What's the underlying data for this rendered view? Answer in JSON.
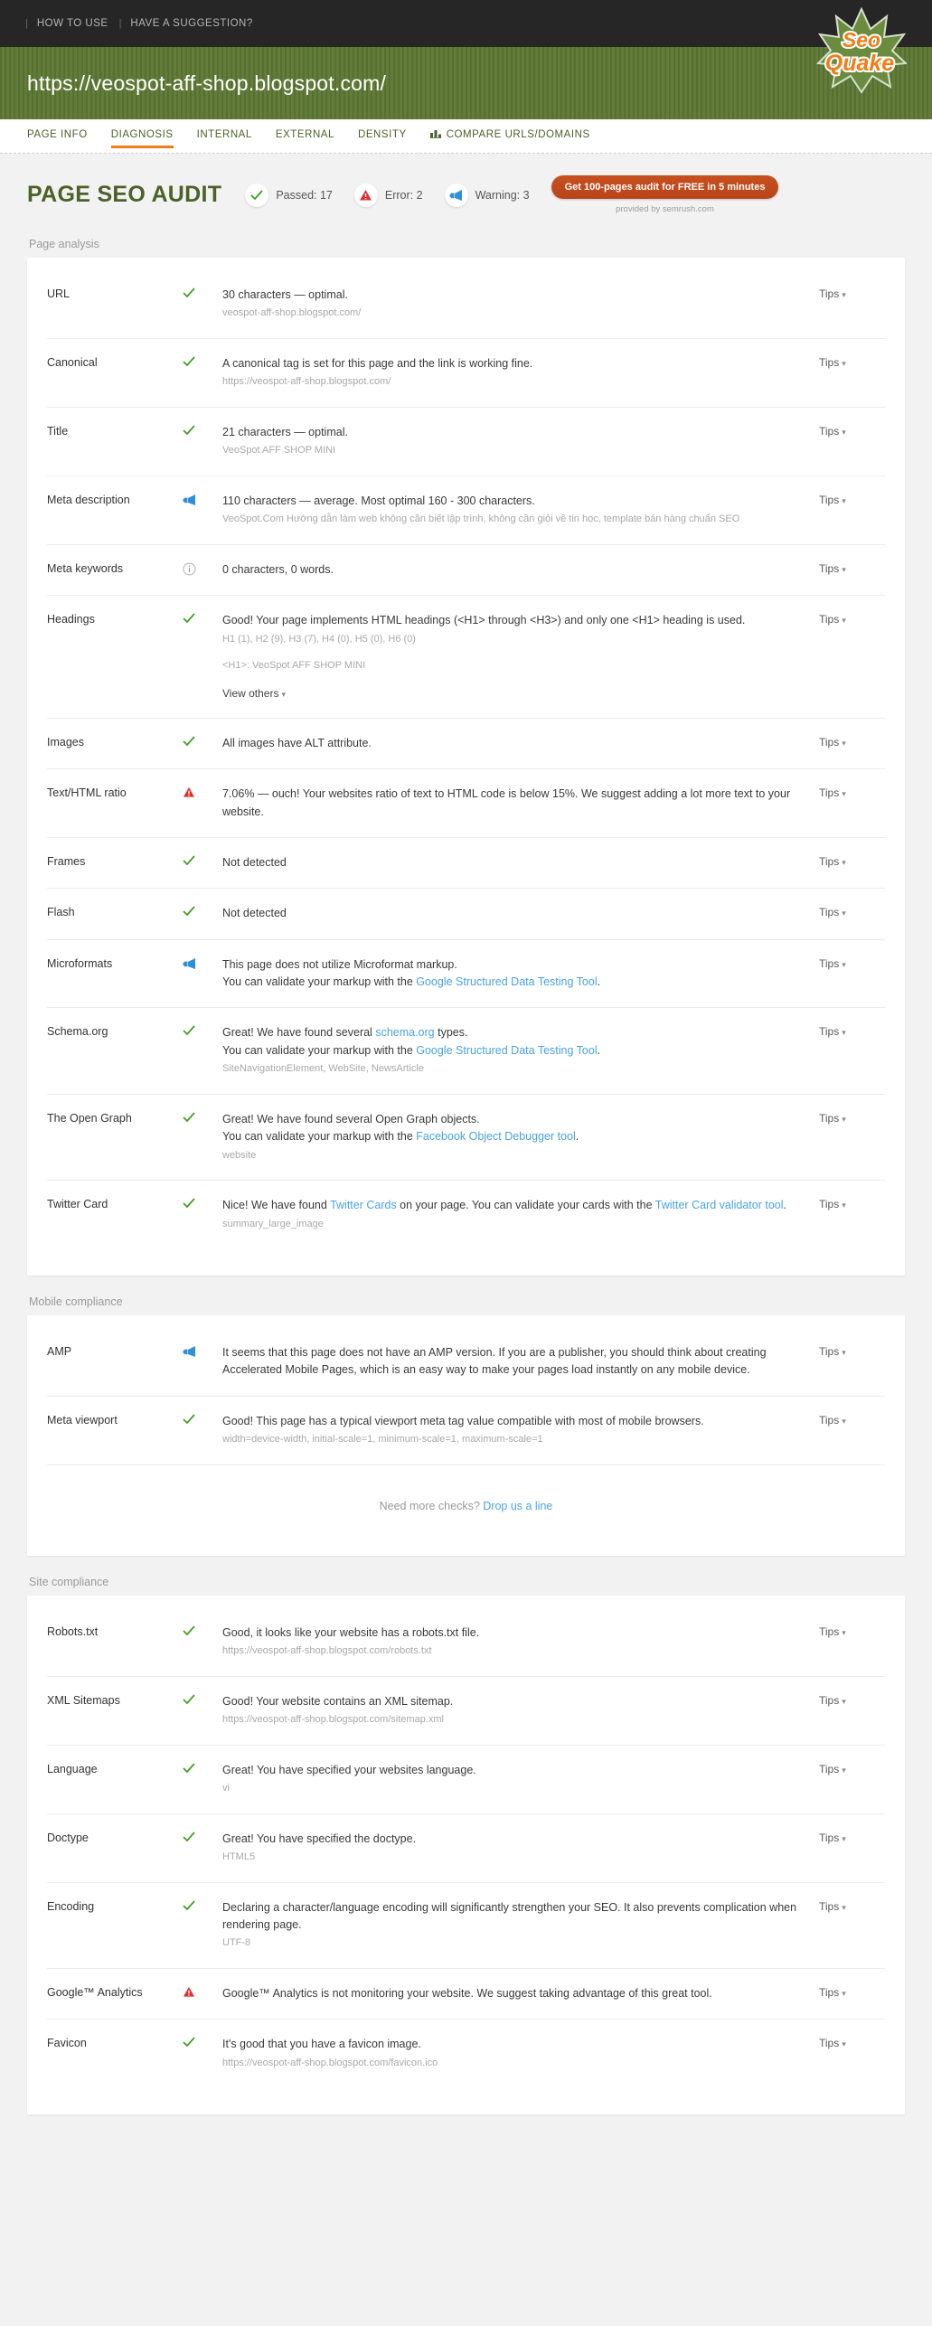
{
  "topbar": {
    "links": [
      {
        "label": "HOW TO USE",
        "name": "how-to-use-link"
      },
      {
        "label": "HAVE A SUGGESTION?",
        "name": "have-a-suggestion-link"
      }
    ],
    "separator": "|"
  },
  "urlbar": {
    "url": "https://veospot-aff-shop.blogspot.com/"
  },
  "logo": {
    "text_top": "Seo",
    "text_bottom": "Quake",
    "alt": "SeoQuake logo"
  },
  "tabs": [
    {
      "label": "PAGE INFO",
      "active": false
    },
    {
      "label": "DIAGNOSIS",
      "active": true
    },
    {
      "label": "INTERNAL",
      "active": false
    },
    {
      "label": "EXTERNAL",
      "active": false
    },
    {
      "label": "DENSITY",
      "active": false
    },
    {
      "label": "COMPARE URLS/DOMAINS",
      "active": false,
      "icon": "bar-chart-icon"
    }
  ],
  "audit": {
    "title": "PAGE SEO AUDIT",
    "stats": [
      {
        "icon": "check-icon",
        "label": "Passed: 17"
      },
      {
        "icon": "error-triangle-icon",
        "label": "Error: 2"
      },
      {
        "icon": "megaphone-icon",
        "label": "Warning: 3"
      }
    ],
    "cta_label": "Get 100-pages audit for FREE in 5 minutes",
    "cta_sub": "provided by  semrush.com"
  },
  "colors": {
    "green": "#5c7733",
    "orange": "#f07d1a",
    "link": "#4aa3df",
    "check": "#3e9c1f",
    "error": "#e03131",
    "warning": "#2f8fd9",
    "cta": "#c8501f"
  },
  "sections": [
    {
      "title": "Page analysis",
      "rows": [
        {
          "label": "URL",
          "icon": "check-icon",
          "tips": "Tips",
          "main": [
            {
              "t": "30 characters — optimal."
            }
          ],
          "sub": [
            "veospot-aff-shop.blogspot.com/"
          ]
        },
        {
          "label": "Canonical",
          "icon": "check-icon",
          "tips": "Tips",
          "main": [
            {
              "t": "A canonical tag is set for this page and the link is working fine."
            }
          ],
          "sub": [
            "https://veospot-aff-shop.blogspot.com/"
          ]
        },
        {
          "label": "Title",
          "icon": "check-icon",
          "tips": "Tips",
          "main": [
            {
              "t": "21 characters — optimal."
            }
          ],
          "sub": [
            "VeoSpot AFF SHOP MINI"
          ]
        },
        {
          "label": "Meta description",
          "icon": "megaphone-icon",
          "tips": "Tips",
          "main": [
            {
              "t": "110 characters — average. Most optimal 160 - 300 characters."
            }
          ],
          "sub": [
            "VeoSpot.Com Hướng dẫn làm web không cần biết lập trình, không cần giỏi về tin học, template bán hàng chuẩn SEO"
          ]
        },
        {
          "label": "Meta keywords",
          "icon": "info-icon",
          "tips": "Tips",
          "main": [
            {
              "t": "0 characters, 0 words."
            }
          ],
          "sub": []
        },
        {
          "label": "Headings",
          "icon": "check-icon",
          "tips": "Tips",
          "main": [
            {
              "t": "Good! Your page implements HTML headings (<H1> through <H3>) and only one <H1> heading is used."
            }
          ],
          "sub": [
            "H1 (1), H2 (9), H3 (7), H4 (0), H5 (0), H6 (0)"
          ],
          "sub_gap": [
            "<H1>: VeoSpot AFF SHOP MINI"
          ],
          "view_others": "View others"
        },
        {
          "label": "Images",
          "icon": "check-icon",
          "tips": "Tips",
          "main": [
            {
              "t": "All images have ALT attribute."
            }
          ],
          "sub": []
        },
        {
          "label": "Text/HTML ratio",
          "icon": "error-triangle-icon",
          "tips": "Tips",
          "main": [
            {
              "t": "7.06% — ouch! Your websites ratio of text to HTML code is below 15%. We suggest adding a lot more text to your website."
            }
          ],
          "sub": []
        },
        {
          "label": "Frames",
          "icon": "check-icon",
          "tips": "Tips",
          "main": [
            {
              "t": "Not detected"
            }
          ],
          "sub": []
        },
        {
          "label": "Flash",
          "icon": "check-icon",
          "tips": "Tips",
          "main": [
            {
              "t": "Not detected"
            }
          ],
          "sub": []
        },
        {
          "label": "Microformats",
          "icon": "megaphone-icon",
          "tips": "Tips",
          "main": [
            {
              "t": "This page does not utilize Microformat markup."
            },
            {
              "br": true
            },
            {
              "t": "You can validate your markup with the "
            },
            {
              "t": "Google Structured Data Testing Tool",
              "link": true
            },
            {
              "t": "."
            }
          ],
          "sub": []
        },
        {
          "label": "Schema.org",
          "icon": "check-icon",
          "tips": "Tips",
          "main": [
            {
              "t": "Great! We have found several "
            },
            {
              "t": "schema.org",
              "link": true
            },
            {
              "t": " types."
            },
            {
              "br": true
            },
            {
              "t": "You can validate your markup with the "
            },
            {
              "t": "Google Structured Data Testing Tool",
              "link": true
            },
            {
              "t": "."
            }
          ],
          "sub": [
            "SiteNavigationElement, WebSite, NewsArticle"
          ]
        },
        {
          "label": "The Open Graph",
          "icon": "check-icon",
          "tips": "Tips",
          "main": [
            {
              "t": "Great! We have found several Open Graph objects."
            },
            {
              "br": true
            },
            {
              "t": "You can validate your markup with the "
            },
            {
              "t": "Facebook Object Debugger tool",
              "link": true
            },
            {
              "t": "."
            }
          ],
          "sub": [
            "website"
          ]
        },
        {
          "label": "Twitter Card",
          "icon": "check-icon",
          "tips": "Tips",
          "main": [
            {
              "t": "Nice! We have found "
            },
            {
              "t": "Twitter Cards",
              "link": true
            },
            {
              "t": " on your page. You can validate your cards with the "
            },
            {
              "t": "Twitter Card validator tool",
              "link": true
            },
            {
              "t": "."
            }
          ],
          "sub": [
            "summary_large_image"
          ]
        }
      ]
    },
    {
      "title": "Mobile compliance",
      "footer": {
        "text": "Need more checks? ",
        "link": "Drop us a line"
      },
      "rows": [
        {
          "label": "AMP",
          "icon": "megaphone-icon",
          "tips": "Tips",
          "main": [
            {
              "t": "It seems that this page does not have an AMP version. If you are a publisher, you should think about creating Accelerated Mobile Pages, which is an easy way to make your pages load instantly on any mobile device."
            }
          ],
          "sub": []
        },
        {
          "label": "Meta viewport",
          "icon": "check-icon",
          "tips": "Tips",
          "main": [
            {
              "t": "Good! This page has a typical viewport meta tag value compatible with most of mobile browsers."
            }
          ],
          "sub": [
            "width=device-width, initial-scale=1, minimum-scale=1, maximum-scale=1"
          ]
        }
      ]
    },
    {
      "title": "Site compliance",
      "rows": [
        {
          "label": "Robots.txt",
          "icon": "check-icon",
          "tips": "Tips",
          "main": [
            {
              "t": "Good, it looks like your website has a robots.txt file."
            }
          ],
          "sub": [
            "https://veospot-aff-shop.blogspot.com/robots.txt"
          ]
        },
        {
          "label": "XML Sitemaps",
          "icon": "check-icon",
          "tips": "Tips",
          "main": [
            {
              "t": "Good! Your website contains an XML sitemap."
            }
          ],
          "sub": [
            "https://veospot-aff-shop.blogspot.com/sitemap.xml"
          ]
        },
        {
          "label": "Language",
          "icon": "check-icon",
          "tips": "Tips",
          "main": [
            {
              "t": "Great! You have specified your websites language."
            }
          ],
          "sub": [
            "vi"
          ]
        },
        {
          "label": "Doctype",
          "icon": "check-icon",
          "tips": "Tips",
          "main": [
            {
              "t": "Great! You have specified the doctype."
            }
          ],
          "sub": [
            "HTML5"
          ]
        },
        {
          "label": "Encoding",
          "icon": "check-icon",
          "tips": "Tips",
          "main": [
            {
              "t": "Declaring a character/language encoding will significantly strengthen your SEO. It also prevents complication when rendering page."
            }
          ],
          "sub": [
            "UTF-8"
          ]
        },
        {
          "label": "Google™ Analytics",
          "icon": "error-triangle-icon",
          "tips": "Tips",
          "main": [
            {
              "t": "Google™ Analytics is not monitoring your website. We suggest taking advantage of this great tool."
            }
          ],
          "sub": []
        },
        {
          "label": "Favicon",
          "icon": "check-icon",
          "tips": "Tips",
          "main": [
            {
              "t": "It's good that you have a favicon image."
            }
          ],
          "sub": [
            "https://veospot-aff-shop.blogspot.com/favicon.ico"
          ]
        }
      ]
    }
  ]
}
